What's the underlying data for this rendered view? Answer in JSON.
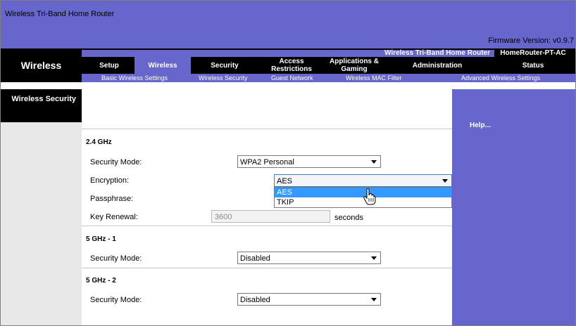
{
  "header": {
    "title": "Wireless Tri-Band Home Router",
    "firmware": "Firmware Version: v0.9.7",
    "product_name": "Wireless Tri-Band Home Router",
    "model_name": "HomeRouter-PT-AC",
    "section_label": "Wireless"
  },
  "tabs": [
    {
      "label": "Setup"
    },
    {
      "label": "Wireless"
    },
    {
      "label": "Security"
    },
    {
      "label": "Access Restrictions"
    },
    {
      "label": "Applications & Gaming"
    },
    {
      "label": "Administration"
    },
    {
      "label": "Status"
    }
  ],
  "subnav": [
    {
      "label": "Basic Wireless Settings"
    },
    {
      "label": "Wireless Security"
    },
    {
      "label": "Guest Network"
    },
    {
      "label": "Wireless MAC Filter"
    },
    {
      "label": "Advanced Wireless Settings"
    }
  ],
  "page": {
    "section_title": "Wireless Security",
    "help": "Help..."
  },
  "band24": {
    "heading": "2.4 GHz",
    "security_mode_label": "Security Mode:",
    "security_mode_value": "WPA2 Personal",
    "encryption_label": "Encryption:",
    "encryption_value": "AES",
    "encryption_options": [
      "AES",
      "TKIP"
    ],
    "passphrase_label": "Passphrase:",
    "key_renewal_label": "Key Renewal:",
    "key_renewal_value": "3600",
    "key_renewal_unit": "seconds"
  },
  "band5_1": {
    "heading": "5 GHz - 1",
    "security_mode_label": "Security Mode:",
    "security_mode_value": "Disabled"
  },
  "band5_2": {
    "heading": "5 GHz - 2",
    "security_mode_label": "Security Mode:",
    "security_mode_value": "Disabled"
  },
  "colors": {
    "accent": "#6666cc",
    "nav_background": "#000000",
    "highlight": "#3399ff"
  }
}
